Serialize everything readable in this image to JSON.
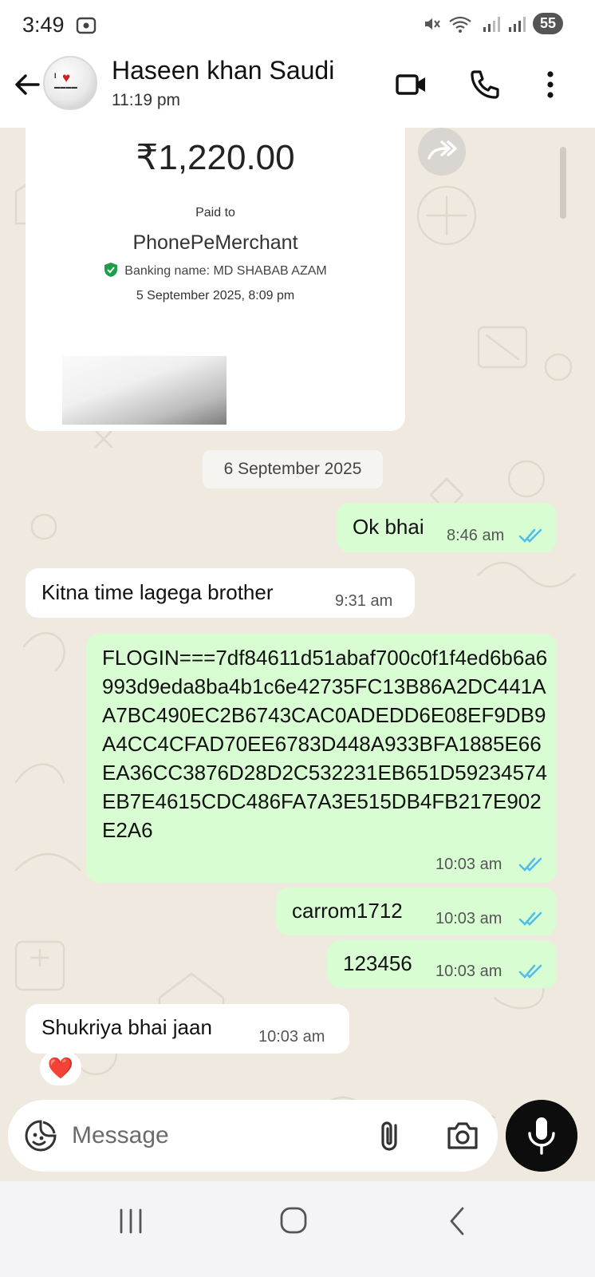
{
  "status_bar": {
    "time": "3:49",
    "battery": "55"
  },
  "header": {
    "contact_name": "Haseen khan Saudi",
    "last_seen": "11:19 pm"
  },
  "payment_card": {
    "amount": "₹1,220.00",
    "paid_to_label": "Paid to",
    "merchant": "PhonePeMerchant",
    "banking_name": "Banking name: MD SHABAB AZAM",
    "date": "5 September 2025, 8:09 pm"
  },
  "date_divider": "6 September 2025",
  "messages": [
    {
      "direction": "out",
      "text": "Ok bhai",
      "time": "8:46 am",
      "read": true
    },
    {
      "direction": "in",
      "text": "Kitna time lagega brother",
      "time": "9:31 am"
    },
    {
      "direction": "out",
      "text": "FLOGIN===7df84611d51abaf700c0f1f4ed6b6a6993d9eda8ba4b1c6e42735FC13B86A2DC441AA7BC490EC2B6743CAC0ADEDD6E08EF9DB9A4CC4CFAD70EE6783D448A933BFA1885E66EA36CC3876D28D2C532231EB651D59234574EB7E4615CDC486FA7A3E515DB4FB217E902E2A6",
      "time": "10:03 am",
      "read": true
    },
    {
      "direction": "out",
      "text": "carrom1712",
      "time": "10:03 am",
      "read": true
    },
    {
      "direction": "out",
      "text": "123456",
      "time": "10:03 am",
      "read": true
    },
    {
      "direction": "in",
      "text": "Shukriya bhai jaan",
      "time": "10:03 am",
      "reaction": "❤️"
    }
  ],
  "composer": {
    "placeholder": "Message"
  },
  "icons": {
    "header": [
      "back-arrow-icon",
      "video-call-icon",
      "voice-call-icon",
      "more-options-icon"
    ],
    "composer": [
      "emoji-sticker-icon",
      "attach-icon",
      "camera-icon",
      "mic-icon"
    ],
    "nav": [
      "recent-apps-icon",
      "home-icon",
      "back-icon"
    ]
  },
  "colors": {
    "outgoing_bubble": "#d9fdd3",
    "incoming_bubble": "#ffffff",
    "read_ticks": "#53bdeb",
    "chat_bg": "#efe9df"
  }
}
